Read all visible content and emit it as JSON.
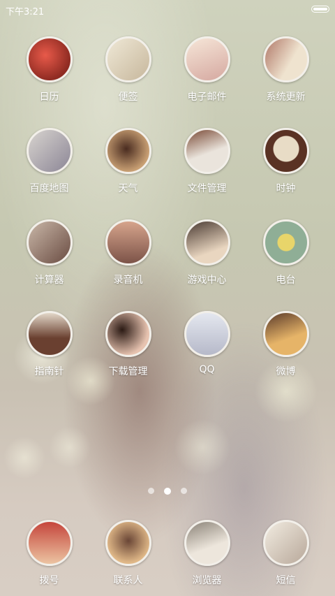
{
  "status_bar": {
    "time": "下午3:21"
  },
  "apps": [
    {
      "label": "日历",
      "icon": "calendar-icon",
      "art": "c-rose"
    },
    {
      "label": "便签",
      "icon": "notes-icon",
      "art": "c-paper"
    },
    {
      "label": "电子邮件",
      "icon": "email-icon",
      "art": "c-gift"
    },
    {
      "label": "系统更新",
      "icon": "system-update-icon",
      "art": "c-book"
    },
    {
      "label": "百度地图",
      "icon": "baidu-map-icon",
      "art": "c-map"
    },
    {
      "label": "天气",
      "icon": "weather-icon",
      "art": "c-hair"
    },
    {
      "label": "文件管理",
      "icon": "file-manager-icon",
      "art": "c-keys"
    },
    {
      "label": "时钟",
      "icon": "clock-icon",
      "art": "c-clock"
    },
    {
      "label": "计算器",
      "icon": "calculator-icon",
      "art": "c-lamp"
    },
    {
      "label": "录音机",
      "icon": "recorder-icon",
      "art": "c-build"
    },
    {
      "label": "游戏中心",
      "icon": "game-center-icon",
      "art": "c-sweet"
    },
    {
      "label": "电台",
      "icon": "radio-icon",
      "art": "c-radio"
    },
    {
      "label": "指南针",
      "icon": "compass-icon",
      "art": "c-bag"
    },
    {
      "label": "下载管理",
      "icon": "download-manager-icon",
      "art": "c-umbr"
    },
    {
      "label": "QQ",
      "icon": "qq-icon",
      "art": "c-eiff"
    },
    {
      "label": "微博",
      "icon": "weibo-icon",
      "art": "c-city"
    }
  ],
  "page_indicator": {
    "count": 3,
    "active_index": 1
  },
  "dock": [
    {
      "label": "拨号",
      "icon": "phone-dialer-icon",
      "art": "c-booth"
    },
    {
      "label": "联系人",
      "icon": "contacts-icon",
      "art": "c-girl"
    },
    {
      "label": "浏览器",
      "icon": "browser-icon",
      "art": "c-lap"
    },
    {
      "label": "短信",
      "icon": "messages-icon",
      "art": "c-note"
    }
  ]
}
